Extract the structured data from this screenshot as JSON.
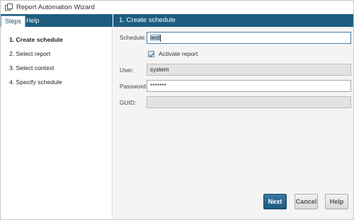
{
  "window": {
    "title": "Report Automation Wizard"
  },
  "left_pane": {
    "tabs": [
      {
        "label": "Steps",
        "active": true
      },
      {
        "label": "Help",
        "active": false
      }
    ],
    "steps": [
      {
        "label": "1. Create schedule",
        "current": true
      },
      {
        "label": "2. Select report",
        "current": false
      },
      {
        "label": "3. Select context",
        "current": false
      },
      {
        "label": "4. Specify schedule",
        "current": false
      }
    ]
  },
  "main": {
    "header": "1. Create schedule",
    "form": {
      "schedule": {
        "label": "Schedule:",
        "value": "test"
      },
      "activate": {
        "label": "Activate report",
        "checked": true
      },
      "user": {
        "label": "User:",
        "value": "system"
      },
      "password": {
        "label": "Password:",
        "value": "*******"
      },
      "guid": {
        "label": "GUID:",
        "value": ""
      }
    }
  },
  "buttons": {
    "next": "Next",
    "cancel": "Cancel",
    "help": "Help"
  },
  "colors": {
    "accent": "#1e5d80",
    "pane_bg": "#f4f4f4",
    "readonly_bg": "#e3e3e3"
  }
}
